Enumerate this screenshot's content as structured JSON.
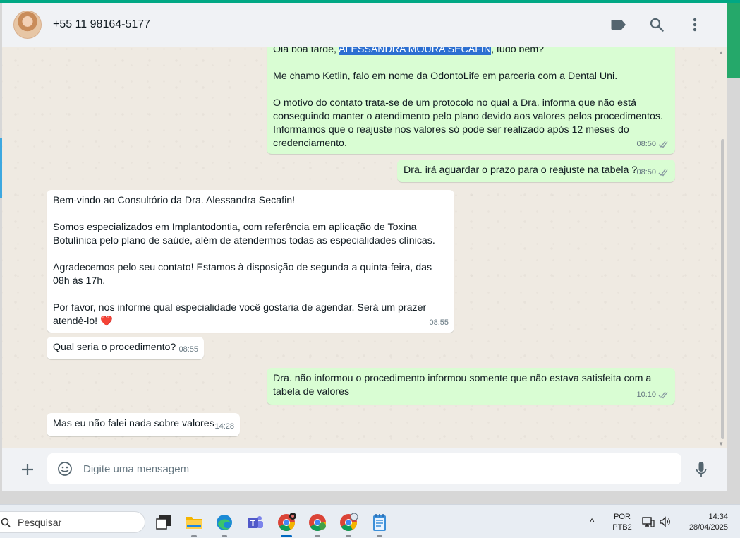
{
  "header": {
    "contact_name": "+55 11 98164-5177"
  },
  "messages": [
    {
      "direction": "out",
      "text_before": "Olá boa tarde, ",
      "highlight": "ALESSANDRA MOURA SECAFIN",
      "text_after": ", tudo bem?\n\nMe chamo Ketlin, falo em nome da OdontoLife em parceria com a Dental Uni.\n\nO motivo do contato trata-se de um protocolo no qual a Dra. informa que não está conseguindo manter o atendimento pelo plano devido aos valores pelos procedimentos. Informamos que o reajuste nos valores só pode ser realizado após 12 meses do credenciamento.",
      "time": "08:50",
      "status": "read"
    },
    {
      "direction": "out",
      "text": "Dra. irá aguardar o prazo para o reajuste na tabela ?",
      "time": "08:50",
      "status": "read"
    },
    {
      "direction": "in",
      "text": "Bem-vindo ao Consultório da Dra. Alessandra Secafin!\n\nSomos especializados em Implantodontia, com referência em aplicação de Toxina Botulínica pelo plano de saúde, além de atendermos todas as especialidades clínicas.\n\nAgradecemos pelo seu contato! Estamos à disposição de segunda a quinta-feira, das 08h às 17h.\n\nPor favor, nos informe qual especialidade você gostaria de agendar. Será um prazer atendê-lo! ❤️",
      "time": "08:55"
    },
    {
      "direction": "in",
      "text": "Qual seria o procedimento?",
      "time": "08:55"
    },
    {
      "direction": "out",
      "text": "Dra. não informou o procedimento informou somente que não estava satisfeita com a tabela de valores",
      "time": "10:10",
      "status": "read"
    },
    {
      "direction": "in",
      "text": "Mas eu não falei nada sobre valores",
      "time": "14:28"
    }
  ],
  "compose": {
    "placeholder": "Digite uma mensagem"
  },
  "taskbar": {
    "search_label": "Pesquisar",
    "lang_line1": "POR",
    "lang_line2": "PTB2",
    "time": "14:34",
    "date": "28/04/2025"
  },
  "colors": {
    "accent": "#00a884",
    "outgoing_bubble": "#d9fdd3",
    "incoming_bubble": "#ffffff",
    "chat_bg": "#efeae2",
    "highlight": "#2c6fd1"
  },
  "icons": [
    "label-icon",
    "search-icon",
    "menu-dots-icon",
    "plus-icon",
    "emoji-icon",
    "mic-icon",
    "double-check-icon",
    "windows-search-icon"
  ]
}
